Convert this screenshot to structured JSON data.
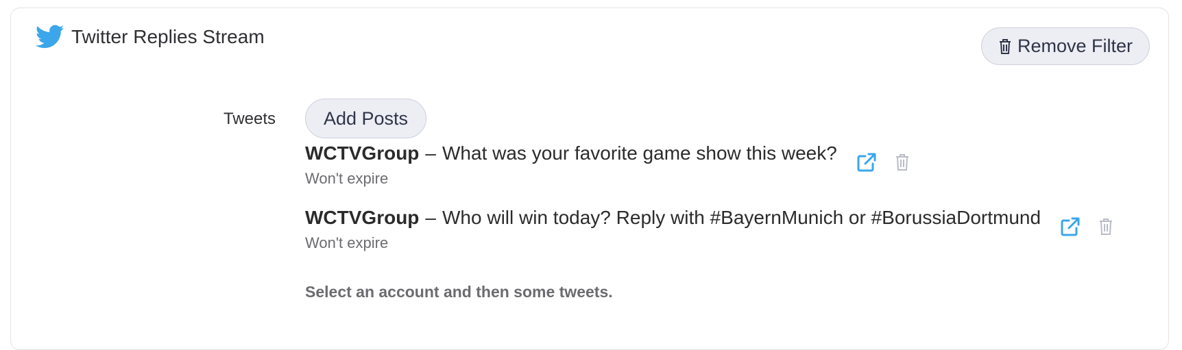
{
  "filter": {
    "title": "Twitter Replies Stream",
    "remove_label": "Remove Filter",
    "icon": "twitter-bird-icon",
    "brand_color": "#3ba6ea"
  },
  "tweets_section": {
    "label": "Tweets",
    "add_label": "Add Posts",
    "items": [
      {
        "account": "WCTVGroup",
        "separator": "–",
        "text": "What was your favorite game show this week?",
        "expiry": "Won't expire"
      },
      {
        "account": "WCTVGroup",
        "separator": "–",
        "text": "Who will win today? Reply with #BayernMunich or #BorussiaDortmund",
        "expiry": "Won't expire"
      }
    ],
    "hint": "Select an account and then some tweets."
  },
  "colors": {
    "link_icon": "#3ba6ea",
    "trash_icon": "#b9bcc8",
    "button_bg": "#eceef4"
  }
}
